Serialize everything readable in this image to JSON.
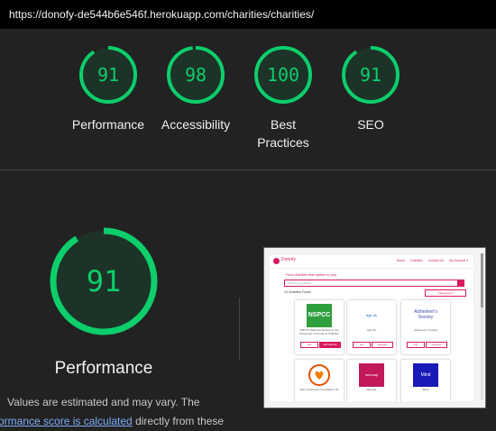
{
  "browser": {
    "url": "https://donofy-de544b6e546f.herokuapp.com/charities/charities/"
  },
  "gauges": [
    {
      "score": "91",
      "label": "Performance"
    },
    {
      "score": "98",
      "label": "Accessibility"
    },
    {
      "score": "100",
      "label": "Best Practices"
    },
    {
      "score": "91",
      "label": "SEO"
    }
  ],
  "perf": {
    "score": "91",
    "title": "Performance",
    "note_line1": "Values are estimated and may vary. The",
    "note_link": "ormance score is calculated",
    "note_line2_tail": " directly from these"
  },
  "colors": {
    "pass": "#0cce6b",
    "brand": "#d81b60"
  },
  "thumbnail": {
    "brand": "Donofy",
    "nav": [
      "Home",
      "Charities",
      "Contact Us",
      "My Account ▾"
    ],
    "heading": "Find charities that matter to you.",
    "search_placeholder": "Search for charities",
    "found": "10 Charities Found",
    "category": "Categories ▾",
    "cards": [
      {
        "name": "NSPCC (National Society for the Prevention of Cruelty to Children)",
        "logo": "NSPCC",
        "logo_bg": "#2e9e3e",
        "btn1": "Info",
        "btn2": "Add favourite"
      },
      {
        "name": "Age UK",
        "logo": "age uk",
        "logo_bg": "#ffffff",
        "btn1": "Info",
        "btn2": "Favourite"
      },
      {
        "name": "Alzheimer's Society",
        "logo": "Alzheimer's Society",
        "logo_bg": "#ffffff",
        "btn1": "Info",
        "btn2": "Favourite"
      },
      {
        "name": "Mary Overhaven Foundation UK",
        "logo": "",
        "logo_bg": "#ffffff",
        "btn1": "",
        "btn2": ""
      },
      {
        "name": "Mencap",
        "logo": "mencap",
        "logo_bg": "#c2185b",
        "btn1": "",
        "btn2": ""
      },
      {
        "name": "Mind",
        "logo": "Mind",
        "logo_bg": "#1a1ab8",
        "btn1": "",
        "btn2": ""
      }
    ]
  }
}
